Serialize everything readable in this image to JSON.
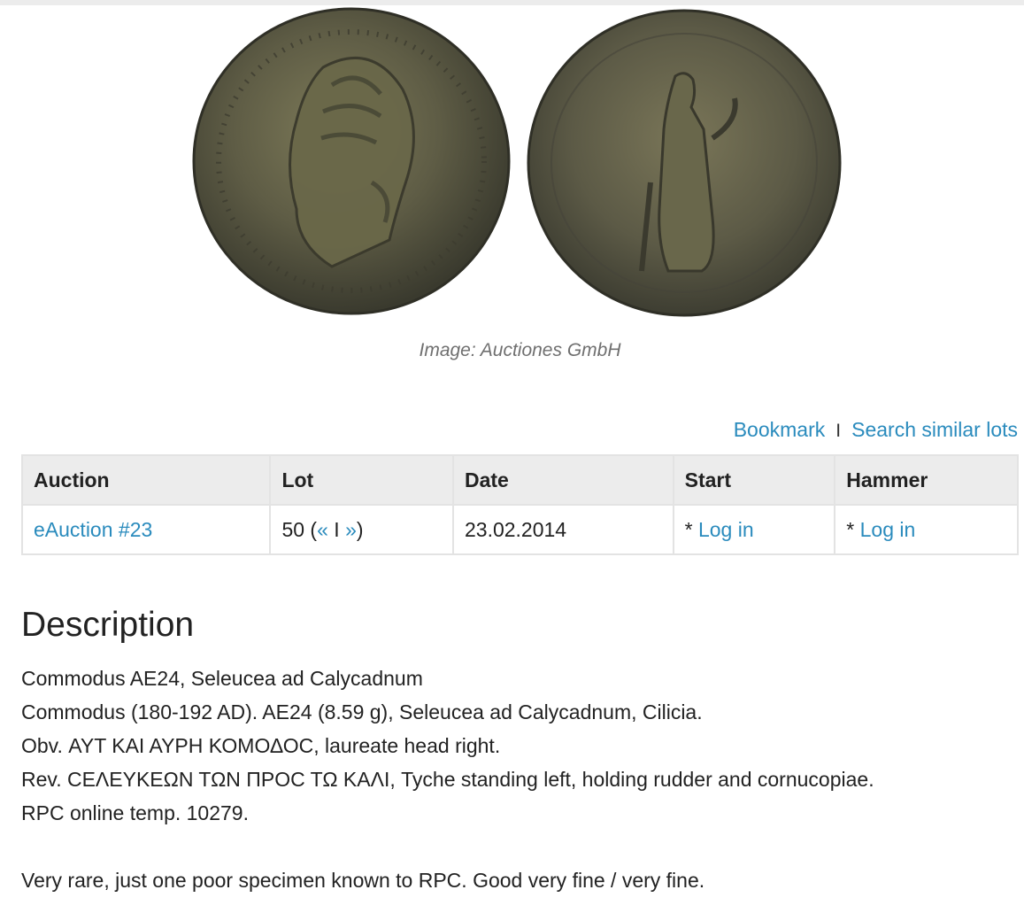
{
  "image": {
    "alt": "Commodus AE24 coin obverse and reverse",
    "caption": "Image: Auctiones GmbH"
  },
  "actions": {
    "bookmark": "Bookmark",
    "separator": "I",
    "search_similar": "Search similar lots"
  },
  "table": {
    "headers": {
      "auction": "Auction",
      "lot": "Lot",
      "date": "Date",
      "start": "Start",
      "hammer": "Hammer"
    },
    "row": {
      "auction": "eAuction #23",
      "lot_number": "50 (",
      "lot_prev": "«",
      "lot_sep": " I ",
      "lot_next": "»",
      "lot_close": ")",
      "date": "23.02.2014",
      "start_prefix": "* ",
      "start_login": "Log in",
      "hammer_prefix": "* ",
      "hammer_login": "Log in"
    }
  },
  "description": {
    "title": "Description",
    "lines": [
      "Commodus AE24, Seleucea ad Calycadnum",
      "Commodus (180-192 AD). AE24 (8.59 g), Seleucea ad Calycadnum, Cilicia.",
      "Obv. ΑΥΤ ΚΑΙ ΑΥΡΗ ΚΟΜΟΔΟϹ, laureate head right.",
      "Rev. ϹΕΛΕΥΚΕΩΝ ΤΩΝ ΠΡΟϹ ΤΩ ΚΑΛΙ, Tyche standing left, holding rudder and cornucopiae.",
      "RPC online temp. 10279.",
      "",
      "Very rare, just one poor specimen known to RPC. Good very fine / very fine."
    ]
  }
}
